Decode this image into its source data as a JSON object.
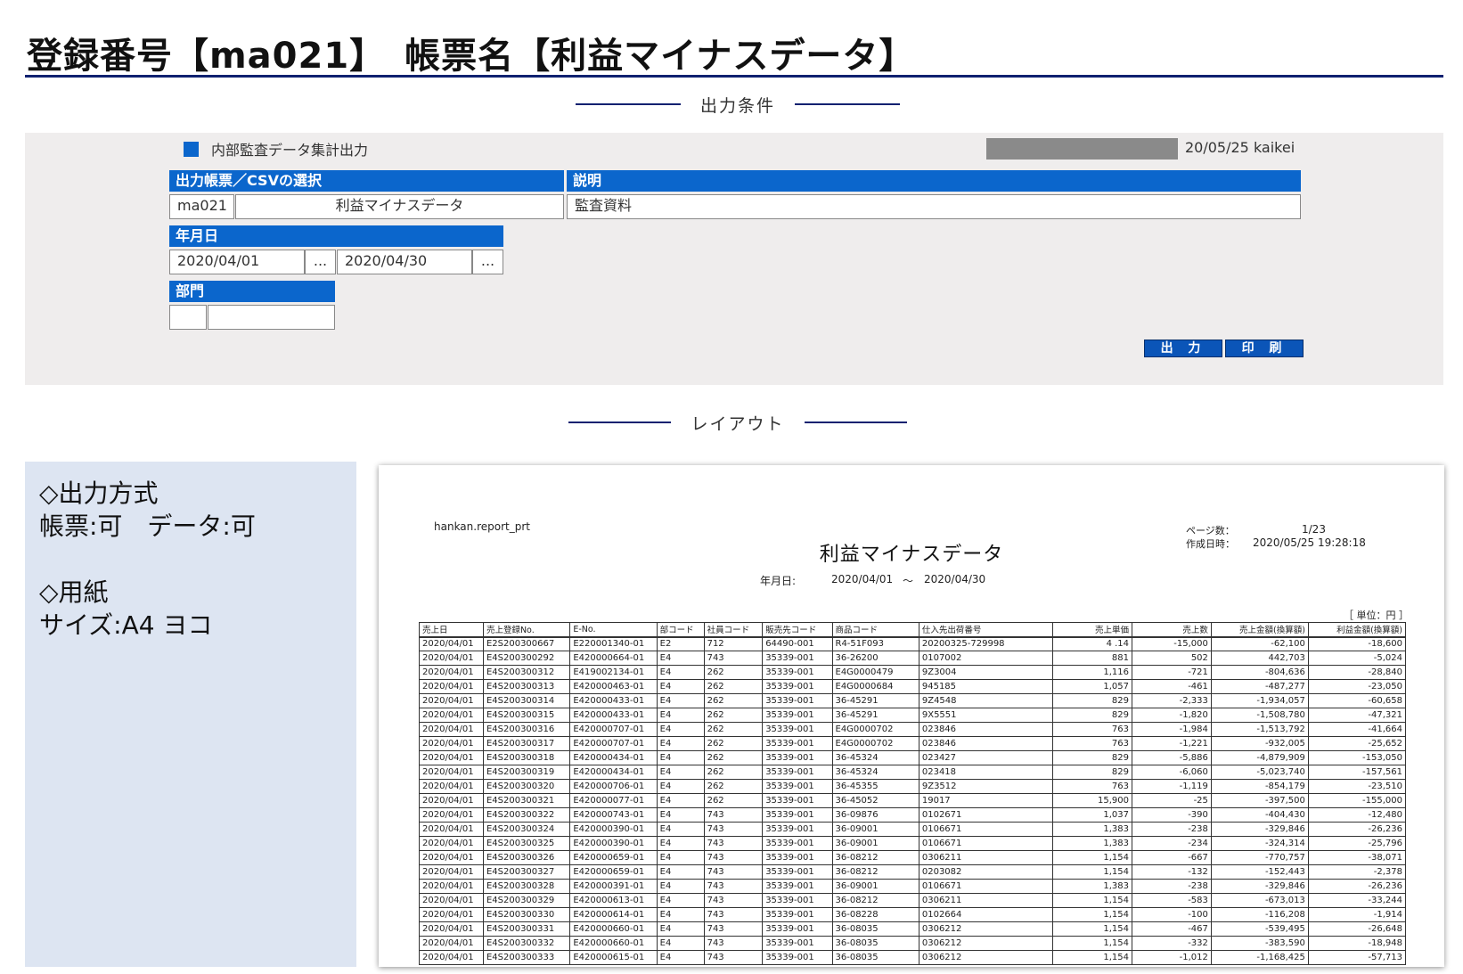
{
  "header": {
    "title": "登録番号【ma021】　帳票名【利益マイナスデータ】"
  },
  "sections": {
    "conditions": "出力条件",
    "layout": "レイアウト"
  },
  "form": {
    "title": "内部監査データ集計出力",
    "date_user": "20/05/25 kaikei",
    "report_select_header": "出力帳票／CSVの選択",
    "description_header": "説明",
    "report_code": "ma021",
    "report_name": "利益マイナスデータ",
    "description": "監査資料",
    "date_header": "年月日",
    "date_from": "2020/04/01",
    "date_to": "2020/04/30",
    "ellipsis": "...",
    "dept_header": "部門",
    "dept_code": "",
    "dept_name": "",
    "output_button": "出 力",
    "print_button": "印 刷"
  },
  "info": {
    "line1": "◇出力方式",
    "line2": "帳票:可　データ:可",
    "line3": "",
    "line4": "◇用紙",
    "line5": "サイズ:A4 ヨコ"
  },
  "report": {
    "program": "hankan.report_prt",
    "title": "利益マイナスデータ",
    "date_label": "年月日:",
    "date_from": "2020/04/01",
    "date_sep": "～",
    "date_to": "2020/04/30",
    "page_label": "ページ数：",
    "page_value": "1/23",
    "created_label": "作成日時：",
    "created_value": "2020/05/25 19:28:18",
    "unit": "［ 単位：円 ］",
    "columns": [
      "売上日",
      "売上登録No.",
      "E-No.",
      "部コード",
      "社員コード",
      "販売先コード",
      "商品コード",
      "仕入先出荷番号",
      "売上単価",
      "売上数",
      "売上金額(換算額)",
      "利益金額(換算額)"
    ],
    "rows": [
      [
        "2020/04/01",
        "E2S200300667",
        "E220001340-01",
        "E2",
        "712",
        "64490-001",
        "R4-51F093",
        "20200325-729998",
        "4 .14",
        "-15,000",
        "-62,100",
        "-18,600"
      ],
      [
        "2020/04/01",
        "E4S200300292",
        "E420000664-01",
        "E4",
        "743",
        "35339-001",
        "36-26200",
        "0107002",
        "881",
        "502",
        "442,703",
        "-5,024"
      ],
      [
        "2020/04/01",
        "E4S200300312",
        "E419002134-01",
        "E4",
        "262",
        "35339-001",
        "E4G0000479",
        "9Z3004",
        "1,116",
        "-721",
        "-804,636",
        "-28,840"
      ],
      [
        "2020/04/01",
        "E4S200300313",
        "E420000463-01",
        "E4",
        "262",
        "35339-001",
        "E4G0000684",
        "945185",
        "1,057",
        "-461",
        "-487,277",
        "-23,050"
      ],
      [
        "2020/04/01",
        "E4S200300314",
        "E420000433-01",
        "E4",
        "262",
        "35339-001",
        "36-45291",
        "9Z4548",
        "829",
        "-2,333",
        "-1,934,057",
        "-60,658"
      ],
      [
        "2020/04/01",
        "E4S200300315",
        "E420000433-01",
        "E4",
        "262",
        "35339-001",
        "36-45291",
        "9X5551",
        "829",
        "-1,820",
        "-1,508,780",
        "-47,321"
      ],
      [
        "2020/04/01",
        "E4S200300316",
        "E420000707-01",
        "E4",
        "262",
        "35339-001",
        "E4G0000702",
        "023846",
        "763",
        "-1,984",
        "-1,513,792",
        "-41,664"
      ],
      [
        "2020/04/01",
        "E4S200300317",
        "E420000707-01",
        "E4",
        "262",
        "35339-001",
        "E4G0000702",
        "023846",
        "763",
        "-1,221",
        "-932,005",
        "-25,652"
      ],
      [
        "2020/04/01",
        "E4S200300318",
        "E420000434-01",
        "E4",
        "262",
        "35339-001",
        "36-45324",
        "023427",
        "829",
        "-5,886",
        "-4,879,909",
        "-153,050"
      ],
      [
        "2020/04/01",
        "E4S200300319",
        "E420000434-01",
        "E4",
        "262",
        "35339-001",
        "36-45324",
        "023418",
        "829",
        "-6,060",
        "-5,023,740",
        "-157,561"
      ],
      [
        "2020/04/01",
        "E4S200300320",
        "E420000706-01",
        "E4",
        "262",
        "35339-001",
        "36-45355",
        "9Z3512",
        "763",
        "-1,119",
        "-854,179",
        "-23,510"
      ],
      [
        "2020/04/01",
        "E4S200300321",
        "E420000077-01",
        "E4",
        "262",
        "35339-001",
        "36-45052",
        "19017",
        "15,900",
        "-25",
        "-397,500",
        "-155,000"
      ],
      [
        "2020/04/01",
        "E4S200300322",
        "E420000743-01",
        "E4",
        "743",
        "35339-001",
        "36-09876",
        "0102671",
        "1,037",
        "-390",
        "-404,430",
        "-12,480"
      ],
      [
        "2020/04/01",
        "E4S200300324",
        "E420000390-01",
        "E4",
        "743",
        "35339-001",
        "36-09001",
        "0106671",
        "1,383",
        "-238",
        "-329,846",
        "-26,236"
      ],
      [
        "2020/04/01",
        "E4S200300325",
        "E420000390-01",
        "E4",
        "743",
        "35339-001",
        "36-09001",
        "0106671",
        "1,383",
        "-234",
        "-324,314",
        "-25,796"
      ],
      [
        "2020/04/01",
        "E4S200300326",
        "E420000659-01",
        "E4",
        "743",
        "35339-001",
        "36-08212",
        "0306211",
        "1,154",
        "-667",
        "-770,757",
        "-38,071"
      ],
      [
        "2020/04/01",
        "E4S200300327",
        "E420000659-01",
        "E4",
        "743",
        "35339-001",
        "36-08212",
        "0203082",
        "1,154",
        "-132",
        "-152,443",
        "-2,378"
      ],
      [
        "2020/04/01",
        "E4S200300328",
        "E420000391-01",
        "E4",
        "743",
        "35339-001",
        "36-09001",
        "0106671",
        "1,383",
        "-238",
        "-329,846",
        "-26,236"
      ],
      [
        "2020/04/01",
        "E4S200300329",
        "E420000613-01",
        "E4",
        "743",
        "35339-001",
        "36-08212",
        "0306211",
        "1,154",
        "-583",
        "-673,013",
        "-33,244"
      ],
      [
        "2020/04/01",
        "E4S200300330",
        "E420000614-01",
        "E4",
        "743",
        "35339-001",
        "36-08228",
        "0102664",
        "1,154",
        "-100",
        "-116,208",
        "-1,914"
      ],
      [
        "2020/04/01",
        "E4S200300331",
        "E420000660-01",
        "E4",
        "743",
        "35339-001",
        "36-08035",
        "0306212",
        "1,154",
        "-467",
        "-539,495",
        "-26,648"
      ],
      [
        "2020/04/01",
        "E4S200300332",
        "E420000660-01",
        "E4",
        "743",
        "35339-001",
        "36-08035",
        "0306212",
        "1,154",
        "-332",
        "-383,590",
        "-18,948"
      ],
      [
        "2020/04/01",
        "E4S200300333",
        "E420000615-01",
        "E4",
        "743",
        "35339-001",
        "36-08035",
        "0306212",
        "1,154",
        "-1,012",
        "-1,168,425",
        "-57,713"
      ]
    ]
  }
}
